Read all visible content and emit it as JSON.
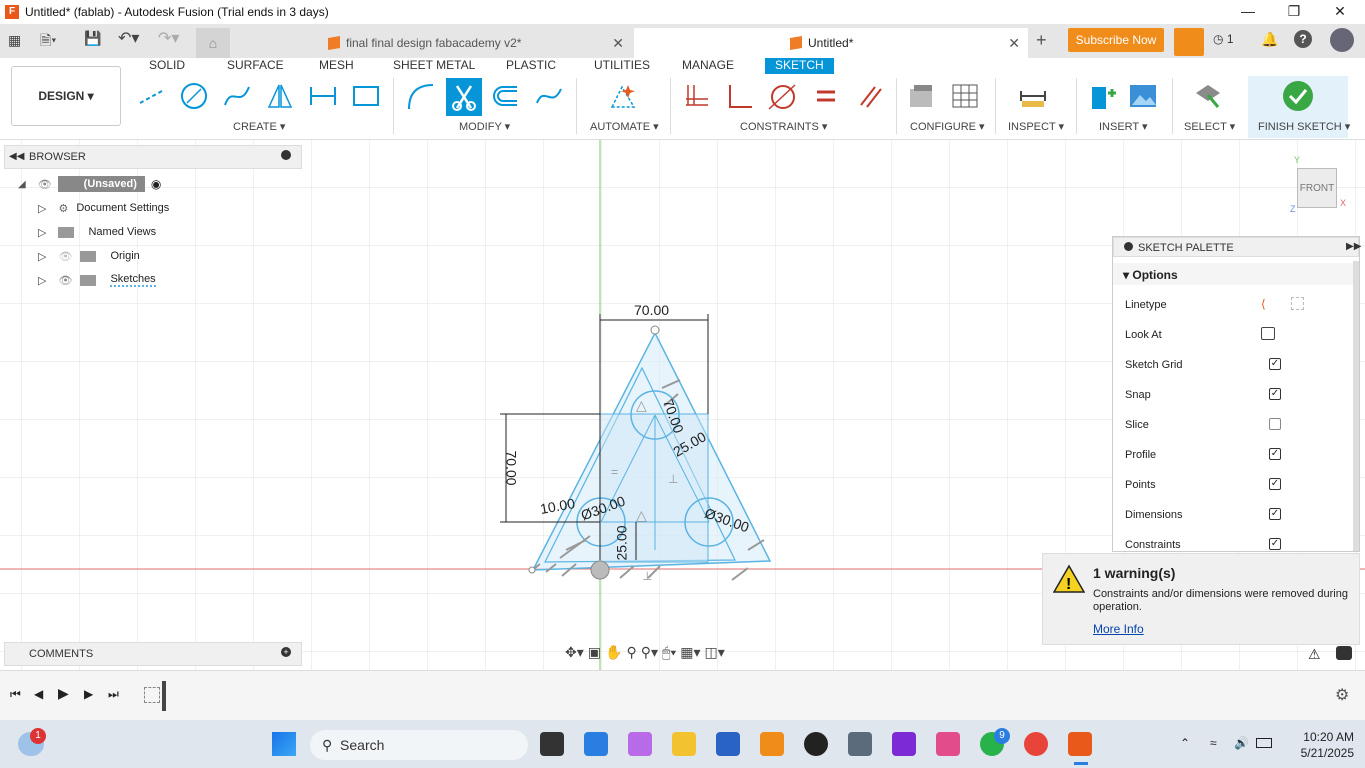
{
  "window": {
    "title": "Untitled* (fablab) - Autodesk Fusion (Trial ends in 3 days)"
  },
  "tabs": [
    {
      "label": "final final design fabacademy v2*"
    },
    {
      "label": "Untitled*"
    }
  ],
  "header": {
    "subscribe": "Subscribe Now",
    "jobs_count": "1"
  },
  "design_label": "DESIGN",
  "workspace_tabs": [
    "SOLID",
    "SURFACE",
    "MESH",
    "SHEET METAL",
    "PLASTIC",
    "UTILITIES",
    "MANAGE",
    "SKETCH"
  ],
  "groups": [
    "CREATE",
    "MODIFY",
    "AUTOMATE",
    "CONSTRAINTS",
    "CONFIGURE",
    "INSPECT",
    "INSERT",
    "SELECT",
    "FINISH SKETCH"
  ],
  "browser": {
    "title": "BROWSER",
    "root": "(Unsaved)",
    "items": [
      "Document Settings",
      "Named Views",
      "Origin",
      "Sketches"
    ]
  },
  "comments": {
    "title": "COMMENTS"
  },
  "viewcube": {
    "face": "FRONT",
    "axis_y": "Y",
    "axis_x": "X",
    "axis_z": "Z"
  },
  "dimensions": {
    "width": "70.00",
    "height": "70.00",
    "d1": "Ø30.00",
    "d2": "Ø30.00",
    "d3": "Ø30.00",
    "l1": "25.00",
    "l2": "25.00",
    "l3": "10.00",
    "l4": "70.00"
  },
  "palette": {
    "title": "SKETCH PALETTE",
    "section": "Options",
    "rows": [
      {
        "label": "Linetype",
        "type": "icons"
      },
      {
        "label": "Look At",
        "type": "icon"
      },
      {
        "label": "Sketch Grid",
        "checked": true
      },
      {
        "label": "Snap",
        "checked": true
      },
      {
        "label": "Slice",
        "checked": false
      },
      {
        "label": "Profile",
        "checked": true
      },
      {
        "label": "Points",
        "checked": true
      },
      {
        "label": "Dimensions",
        "checked": true
      },
      {
        "label": "Constraints",
        "checked": true
      }
    ]
  },
  "warning": {
    "title": "1 warning(s)",
    "message": "Constraints and/or dimensions were removed during operation.",
    "link": "More Info"
  },
  "taskbar": {
    "search": "Search",
    "time": "10:20 AM",
    "date": "5/21/2025",
    "weather_badge": "1",
    "whatsapp_badge": "9"
  },
  "colors": {
    "accent": "#0696d7",
    "orange": "#f08c1a",
    "sketch": "#4fb3e0"
  }
}
